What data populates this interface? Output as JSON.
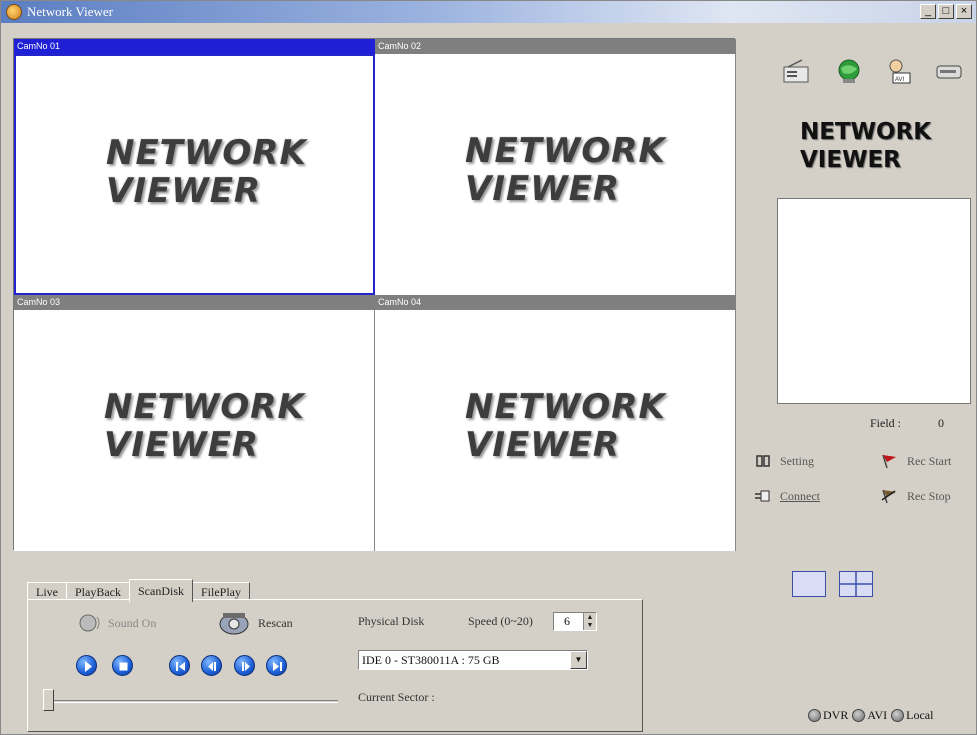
{
  "window": {
    "title": "Network Viewer",
    "minimize": "_",
    "restore": "□",
    "close": "×"
  },
  "cameras": [
    {
      "label": "CamNo 01",
      "logo_line1": "NETWORK",
      "logo_line2": "VIEWER"
    },
    {
      "label": "CamNo 02",
      "logo_line1": "NETWORK",
      "logo_line2": "VIEWER"
    },
    {
      "label": "CamNo 03",
      "logo_line1": "NETWORK",
      "logo_line2": "VIEWER"
    },
    {
      "label": "CamNo 04",
      "logo_line1": "NETWORK",
      "logo_line2": "VIEWER"
    }
  ],
  "side": {
    "title_line1": "NETWORK",
    "title_line2": "VIEWER",
    "field_label": "Field :",
    "field_value": "0",
    "setting": "Setting",
    "connect": "Connect",
    "rec_start": "Rec Start",
    "rec_stop": "Rec Stop",
    "radio_dvr": "DVR",
    "radio_avi": "AVI",
    "radio_local": "Local"
  },
  "tabs": [
    "Live",
    "PlayBack",
    "ScanDisk",
    "FilePlay"
  ],
  "active_tab": "ScanDisk",
  "scandisk": {
    "sound_label": "Sound On",
    "rescan_label": "Rescan",
    "physical_disk_label": "Physical Disk",
    "speed_label": "Speed (0~20)",
    "speed_value": "6",
    "disk_option": "IDE 0 - ST380011A : 75 GB",
    "current_sector_label": "Current Sector :",
    "slider_position": 0
  },
  "colors": {
    "active_cam_header": "#1f1fd6",
    "inactive_cam_header": "#7f7f7f",
    "window_face": "#d4d0c8",
    "rec_start_flag": "#c0161b"
  }
}
